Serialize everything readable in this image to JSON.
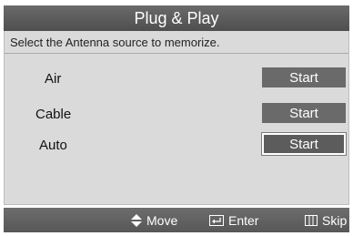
{
  "dialog": {
    "title": "Plug & Play",
    "prompt": "Select the Antenna source to memorize."
  },
  "options": [
    {
      "label": "Air",
      "button": "Start"
    },
    {
      "label": "Cable",
      "button": "Start"
    },
    {
      "label": "Auto",
      "button": "Start"
    }
  ],
  "footer": {
    "move": "Move",
    "enter": "Enter",
    "skip": "Skip"
  },
  "icons": {
    "move": "move-arrows-icon",
    "enter": "enter-icon",
    "skip": "skip-icon"
  }
}
